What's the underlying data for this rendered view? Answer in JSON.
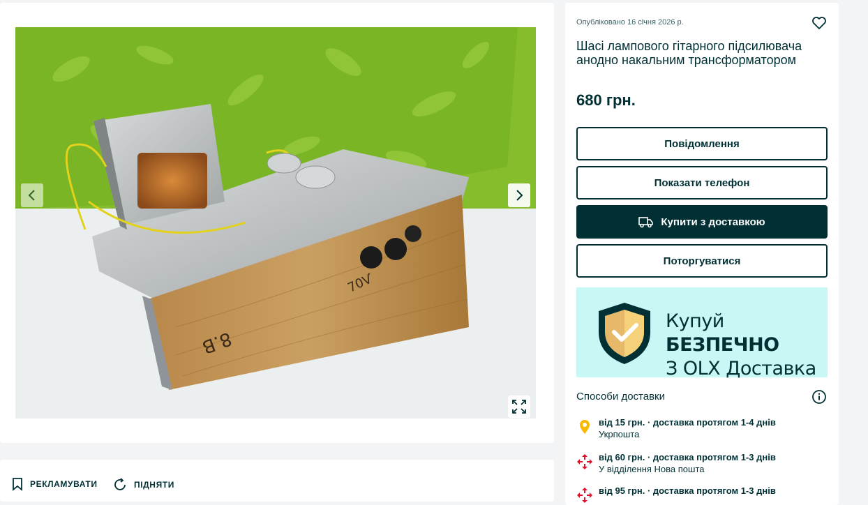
{
  "gallery": {
    "prev_icon": "chevron-left-icon",
    "next_icon": "chevron-right-icon",
    "fullscreen_icon": "expand-icon",
    "photo_marks": [
      "8.B",
      "70Ѵ"
    ]
  },
  "actions": {
    "promote_label": "РЕКЛАМУВАТИ",
    "promote_icon": "bookmark-icon",
    "raise_label": "ПІДНЯТИ",
    "raise_icon": "refresh-icon"
  },
  "ad": {
    "published": "Опубліковано 16 січня 2026 р.",
    "title": "Шасі лампового гітарного підсилювача анодно накальним трансформатором",
    "price": "680 грн.",
    "favorite_icon": "heart-icon"
  },
  "buttons": {
    "message": "Повідомлення",
    "show_phone": "Показати телефон",
    "buy_delivery": "Купити з доставкою",
    "buy_icon": "truck-icon",
    "negotiate": "Поторгуватися"
  },
  "banner": {
    "line1_normal": "Купуй ",
    "line1_bold": "БЕЗПЕЧНО",
    "line2": "З OLX Доставка",
    "icon": "shield-check-icon"
  },
  "delivery": {
    "title": "Способи доставки",
    "info_icon": "info-icon",
    "items": [
      {
        "line1": "від 15 грн. · доставка протягом 1-4 днів",
        "line2": "Укрпошта",
        "icon": "ukrposhta-icon",
        "color": "#f9b800"
      },
      {
        "line1": "від 60 грн. · доставка протягом 1-3 днів",
        "line2": "У відділення Нова пошта",
        "icon": "novaposhta-icon",
        "color": "#e3102a"
      },
      {
        "line1": "від 95 грн. · доставка протягом 1-3 днів",
        "line2": "",
        "icon": "novaposhta-icon",
        "color": "#e3102a"
      }
    ]
  },
  "colors": {
    "primary": "#002f34",
    "banner_bg": "#c8f8f6",
    "page_bg": "#f2f4f5"
  }
}
